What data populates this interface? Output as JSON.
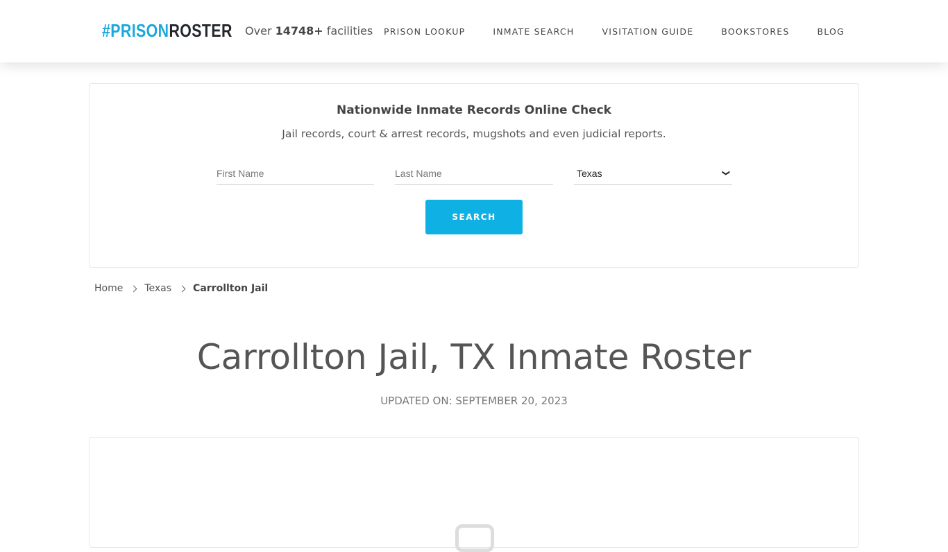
{
  "header": {
    "logo_hash": "#",
    "logo_part1": "PRISON",
    "logo_part2": "ROSTER",
    "facilities_prefix": "Over ",
    "facilities_count": "14748+",
    "facilities_suffix": " facilities",
    "nav": [
      {
        "label": "PRISON LOOKUP"
      },
      {
        "label": "INMATE SEARCH"
      },
      {
        "label": "VISITATION GUIDE"
      },
      {
        "label": "BOOKSTORES"
      },
      {
        "label": "BLOG"
      }
    ]
  },
  "search": {
    "title": "Nationwide Inmate Records Online Check",
    "subtitle": "Jail records, court & arrest records, mugshots and even judicial reports.",
    "first_name_placeholder": "First Name",
    "first_name_value": "",
    "last_name_placeholder": "Last Name",
    "last_name_value": "",
    "state_selected": "Texas",
    "button_label": "SEARCH",
    "accent_color": "#0fb1e4"
  },
  "breadcrumb": {
    "items": [
      {
        "label": "Home"
      },
      {
        "label": "Texas"
      },
      {
        "label": "Carrollton Jail"
      }
    ]
  },
  "page": {
    "title": "Carrollton Jail, TX Inmate Roster",
    "updated": "UPDATED ON: SEPTEMBER 20, 2023"
  }
}
